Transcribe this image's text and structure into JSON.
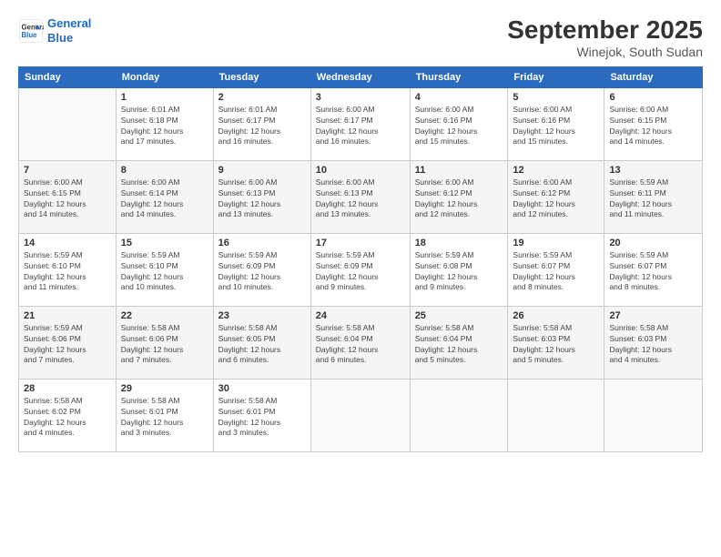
{
  "header": {
    "logo_line1": "General",
    "logo_line2": "Blue",
    "month_title": "September 2025",
    "location": "Winejok, South Sudan"
  },
  "days_of_week": [
    "Sunday",
    "Monday",
    "Tuesday",
    "Wednesday",
    "Thursday",
    "Friday",
    "Saturday"
  ],
  "weeks": [
    [
      {
        "day": "",
        "info": ""
      },
      {
        "day": "1",
        "info": "Sunrise: 6:01 AM\nSunset: 6:18 PM\nDaylight: 12 hours\nand 17 minutes."
      },
      {
        "day": "2",
        "info": "Sunrise: 6:01 AM\nSunset: 6:17 PM\nDaylight: 12 hours\nand 16 minutes."
      },
      {
        "day": "3",
        "info": "Sunrise: 6:00 AM\nSunset: 6:17 PM\nDaylight: 12 hours\nand 16 minutes."
      },
      {
        "day": "4",
        "info": "Sunrise: 6:00 AM\nSunset: 6:16 PM\nDaylight: 12 hours\nand 15 minutes."
      },
      {
        "day": "5",
        "info": "Sunrise: 6:00 AM\nSunset: 6:16 PM\nDaylight: 12 hours\nand 15 minutes."
      },
      {
        "day": "6",
        "info": "Sunrise: 6:00 AM\nSunset: 6:15 PM\nDaylight: 12 hours\nand 14 minutes."
      }
    ],
    [
      {
        "day": "7",
        "info": "Sunrise: 6:00 AM\nSunset: 6:15 PM\nDaylight: 12 hours\nand 14 minutes."
      },
      {
        "day": "8",
        "info": "Sunrise: 6:00 AM\nSunset: 6:14 PM\nDaylight: 12 hours\nand 14 minutes."
      },
      {
        "day": "9",
        "info": "Sunrise: 6:00 AM\nSunset: 6:13 PM\nDaylight: 12 hours\nand 13 minutes."
      },
      {
        "day": "10",
        "info": "Sunrise: 6:00 AM\nSunset: 6:13 PM\nDaylight: 12 hours\nand 13 minutes."
      },
      {
        "day": "11",
        "info": "Sunrise: 6:00 AM\nSunset: 6:12 PM\nDaylight: 12 hours\nand 12 minutes."
      },
      {
        "day": "12",
        "info": "Sunrise: 6:00 AM\nSunset: 6:12 PM\nDaylight: 12 hours\nand 12 minutes."
      },
      {
        "day": "13",
        "info": "Sunrise: 5:59 AM\nSunset: 6:11 PM\nDaylight: 12 hours\nand 11 minutes."
      }
    ],
    [
      {
        "day": "14",
        "info": "Sunrise: 5:59 AM\nSunset: 6:10 PM\nDaylight: 12 hours\nand 11 minutes."
      },
      {
        "day": "15",
        "info": "Sunrise: 5:59 AM\nSunset: 6:10 PM\nDaylight: 12 hours\nand 10 minutes."
      },
      {
        "day": "16",
        "info": "Sunrise: 5:59 AM\nSunset: 6:09 PM\nDaylight: 12 hours\nand 10 minutes."
      },
      {
        "day": "17",
        "info": "Sunrise: 5:59 AM\nSunset: 6:09 PM\nDaylight: 12 hours\nand 9 minutes."
      },
      {
        "day": "18",
        "info": "Sunrise: 5:59 AM\nSunset: 6:08 PM\nDaylight: 12 hours\nand 9 minutes."
      },
      {
        "day": "19",
        "info": "Sunrise: 5:59 AM\nSunset: 6:07 PM\nDaylight: 12 hours\nand 8 minutes."
      },
      {
        "day": "20",
        "info": "Sunrise: 5:59 AM\nSunset: 6:07 PM\nDaylight: 12 hours\nand 8 minutes."
      }
    ],
    [
      {
        "day": "21",
        "info": "Sunrise: 5:59 AM\nSunset: 6:06 PM\nDaylight: 12 hours\nand 7 minutes."
      },
      {
        "day": "22",
        "info": "Sunrise: 5:58 AM\nSunset: 6:06 PM\nDaylight: 12 hours\nand 7 minutes."
      },
      {
        "day": "23",
        "info": "Sunrise: 5:58 AM\nSunset: 6:05 PM\nDaylight: 12 hours\nand 6 minutes."
      },
      {
        "day": "24",
        "info": "Sunrise: 5:58 AM\nSunset: 6:04 PM\nDaylight: 12 hours\nand 6 minutes."
      },
      {
        "day": "25",
        "info": "Sunrise: 5:58 AM\nSunset: 6:04 PM\nDaylight: 12 hours\nand 5 minutes."
      },
      {
        "day": "26",
        "info": "Sunrise: 5:58 AM\nSunset: 6:03 PM\nDaylight: 12 hours\nand 5 minutes."
      },
      {
        "day": "27",
        "info": "Sunrise: 5:58 AM\nSunset: 6:03 PM\nDaylight: 12 hours\nand 4 minutes."
      }
    ],
    [
      {
        "day": "28",
        "info": "Sunrise: 5:58 AM\nSunset: 6:02 PM\nDaylight: 12 hours\nand 4 minutes."
      },
      {
        "day": "29",
        "info": "Sunrise: 5:58 AM\nSunset: 6:01 PM\nDaylight: 12 hours\nand 3 minutes."
      },
      {
        "day": "30",
        "info": "Sunrise: 5:58 AM\nSunset: 6:01 PM\nDaylight: 12 hours\nand 3 minutes."
      },
      {
        "day": "",
        "info": ""
      },
      {
        "day": "",
        "info": ""
      },
      {
        "day": "",
        "info": ""
      },
      {
        "day": "",
        "info": ""
      }
    ]
  ]
}
